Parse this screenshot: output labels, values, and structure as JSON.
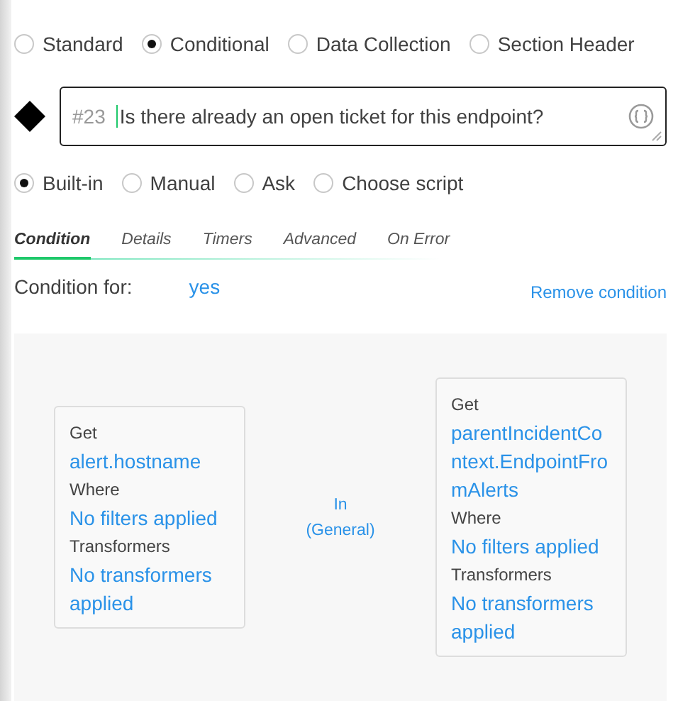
{
  "task_types": [
    {
      "label": "Standard",
      "selected": false
    },
    {
      "label": "Conditional",
      "selected": true
    },
    {
      "label": "Data Collection",
      "selected": false
    },
    {
      "label": "Section Header",
      "selected": false
    }
  ],
  "task": {
    "number": "#23",
    "value": "Is there already an open ticket for this endpoint?"
  },
  "modes": [
    {
      "label": "Built-in",
      "selected": true
    },
    {
      "label": "Manual",
      "selected": false
    },
    {
      "label": "Ask",
      "selected": false
    },
    {
      "label": "Choose script",
      "selected": false
    }
  ],
  "tabs": [
    {
      "label": "Condition",
      "selected": true
    },
    {
      "label": "Details",
      "selected": false
    },
    {
      "label": "Timers",
      "selected": false
    },
    {
      "label": "Advanced",
      "selected": false
    },
    {
      "label": "On Error",
      "selected": false
    }
  ],
  "condition_for": {
    "label": "Condition for:",
    "value": "yes"
  },
  "remove_link": "Remove condition",
  "left_operand": {
    "get_label": "Get",
    "get_value": "alert.hostname",
    "where_label": "Where",
    "where_value": "No filters applied",
    "transformers_label": "Transformers",
    "transformers_value": "No transformers applied"
  },
  "operator": {
    "name": "In",
    "group": "(General)"
  },
  "right_operand": {
    "get_label": "Get",
    "get_value": "parentIncidentContext.EndpointFromAlerts",
    "where_label": "Where",
    "where_value": "No filters applied",
    "transformers_label": "Transformers",
    "transformers_value": "No transformers applied"
  }
}
